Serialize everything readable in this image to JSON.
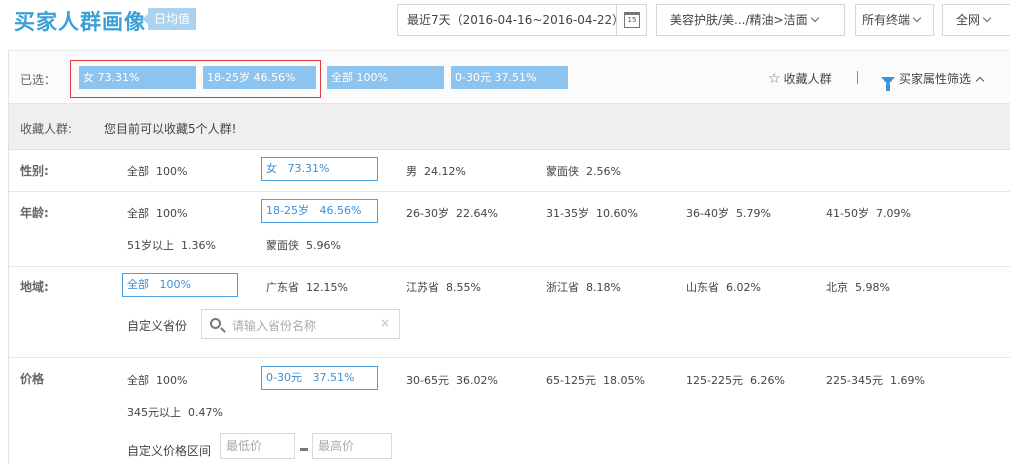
{
  "header": {
    "title": "买家人群画像",
    "daily_tag": "日均值",
    "date_range": "最近7天（2016-04-16~2016-04-22）",
    "calendar_day": "15",
    "category": "美容护肤/美.../精油>洁面",
    "terminal": "所有终端",
    "network": "全网"
  },
  "selected": {
    "label": "已选：",
    "chips": [
      "女 73.31%",
      "18-25岁 46.56%",
      "全部 100%",
      "0-30元 37.51%"
    ],
    "favorite_label": "收藏人群",
    "filter_label": "买家属性筛选"
  },
  "favorites": {
    "label": "收藏人群:",
    "message": "您目前可以收藏5个人群!"
  },
  "gender": {
    "label": "性别:",
    "options": [
      {
        "name": "全部",
        "pct": "100%"
      },
      {
        "name": "女",
        "pct": "73.31%"
      },
      {
        "name": "男",
        "pct": "24.12%"
      },
      {
        "name": "蒙面侠",
        "pct": "2.56%"
      }
    ]
  },
  "age": {
    "label": "年龄:",
    "options": [
      {
        "name": "全部",
        "pct": "100%"
      },
      {
        "name": "18-25岁",
        "pct": "46.56%"
      },
      {
        "name": "26-30岁",
        "pct": "22.64%"
      },
      {
        "name": "31-35岁",
        "pct": "10.60%"
      },
      {
        "name": "36-40岁",
        "pct": "5.79%"
      },
      {
        "name": "41-50岁",
        "pct": "7.09%"
      },
      {
        "name": "51岁以上",
        "pct": "1.36%"
      },
      {
        "name": "蒙面侠",
        "pct": "5.96%"
      }
    ]
  },
  "region": {
    "label": "地域:",
    "options": [
      {
        "name": "全部",
        "pct": "100%"
      },
      {
        "name": "广东省",
        "pct": "12.15%"
      },
      {
        "name": "江苏省",
        "pct": "8.55%"
      },
      {
        "name": "浙江省",
        "pct": "8.18%"
      },
      {
        "name": "山东省",
        "pct": "6.02%"
      },
      {
        "name": "北京",
        "pct": "5.98%"
      }
    ],
    "custom_label": "自定义省份",
    "search_placeholder": "请输入省份名称",
    "clear_glyph": "×"
  },
  "price": {
    "label": "价格",
    "options": [
      {
        "name": "全部",
        "pct": "100%"
      },
      {
        "name": "0-30元",
        "pct": "37.51%"
      },
      {
        "name": "30-65元",
        "pct": "36.02%"
      },
      {
        "name": "65-125元",
        "pct": "18.05%"
      },
      {
        "name": "125-225元",
        "pct": "6.26%"
      },
      {
        "name": "225-345元",
        "pct": "1.69%"
      },
      {
        "name": "345元以上",
        "pct": "0.47%"
      }
    ],
    "custom_label": "自定义价格区间",
    "min_placeholder": "最低价",
    "max_placeholder": "最高价"
  }
}
